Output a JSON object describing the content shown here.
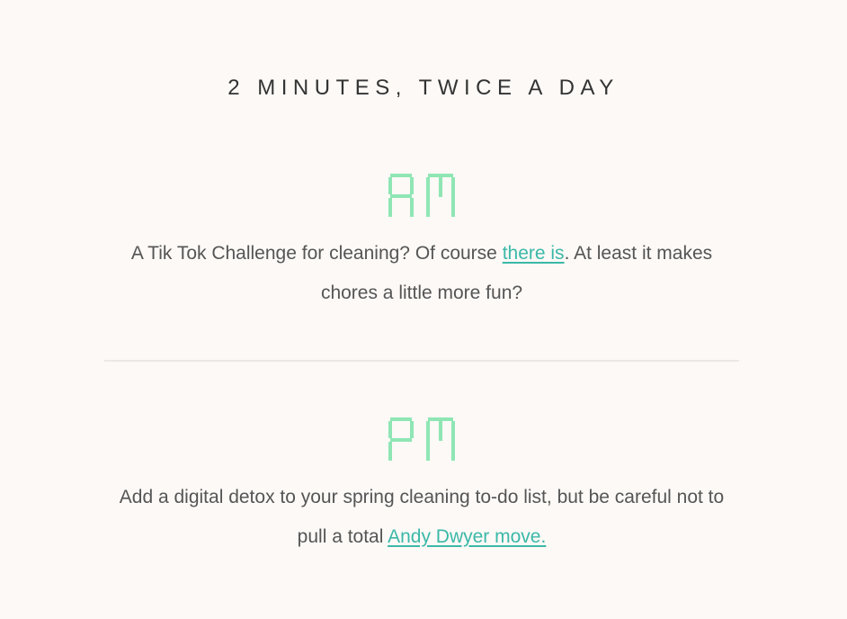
{
  "headline": "2 MINUTES, TWICE A DAY",
  "colors": {
    "background": "#fcf9f6",
    "lcd_green": "#8fe6b4",
    "link": "#3bb8a8",
    "divider": "#ebe8e5"
  },
  "am": {
    "label": "AM",
    "text_before": "A Tik Tok Challenge for cleaning? Of course ",
    "link_text": "there is",
    "text_after": ". At least it makes chores a little more fun?"
  },
  "pm": {
    "label": "PM",
    "text_before": "Add a digital detox to your spring cleaning to-do list, but be careful not to pull a total ",
    "link_text": "Andy Dwyer move.",
    "text_after": ""
  }
}
